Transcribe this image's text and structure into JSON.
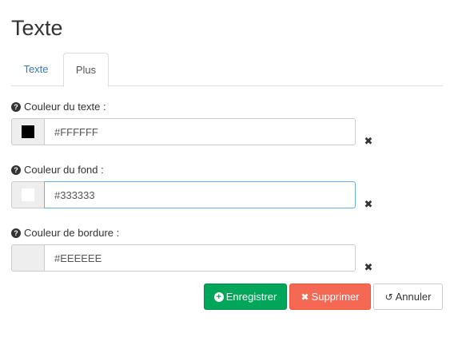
{
  "page": {
    "title": "Texte"
  },
  "tabs": [
    {
      "label": "Texte",
      "active": false
    },
    {
      "label": "Plus",
      "active": true
    }
  ],
  "fields": [
    {
      "label": "Couleur du texte :",
      "value": "#FFFFFF",
      "swatch_color": "#000000"
    },
    {
      "label": "Couleur du fond :",
      "value": "#333333",
      "swatch_color": "#ffffff"
    },
    {
      "label": "Couleur de bordure :",
      "value": "#EEEEEE",
      "swatch_color": "#eeeeee"
    }
  ],
  "buttons": {
    "save_label": "Enregistrer",
    "delete_label": "Supprimer",
    "cancel_label": "Annuler"
  },
  "icons": {
    "help": "question-circle-icon",
    "clear": "times-icon",
    "save": "plus-circle-icon",
    "delete": "times-icon",
    "cancel": "undo-icon"
  },
  "colors": {
    "save": "#00a65a",
    "delete": "#f56954",
    "link": "#337ab7"
  }
}
